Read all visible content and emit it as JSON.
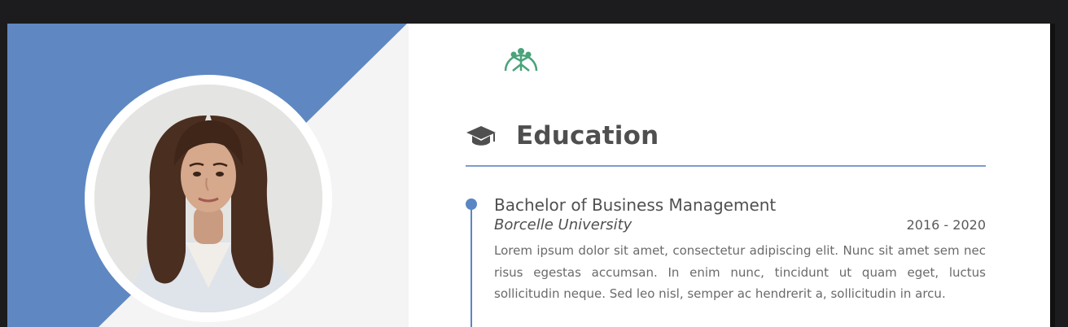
{
  "section": {
    "icon": "graduation-cap-icon",
    "title": "Education"
  },
  "logo": {
    "icon": "tree-emblem-icon",
    "color": "#4aa37a"
  },
  "colors": {
    "accent_blue": "#5f88c2",
    "heading_gray": "#4f4f4f",
    "panel_gray": "#f4f4f4",
    "app_background": "#1c1c1e"
  },
  "education": [
    {
      "degree": "Bachelor of Business Management",
      "school": "Borcelle University",
      "years": "2016 - 2020",
      "description": "Lorem ipsum dolor sit amet, consectetur adipiscing elit. Nunc sit amet sem nec risus egestas accumsan. In enim nunc, tincidunt ut quam eget, luctus sollicitudin neque. Sed leo nisl, semper ac hendrerit a, sollicitudin in arcu."
    }
  ]
}
